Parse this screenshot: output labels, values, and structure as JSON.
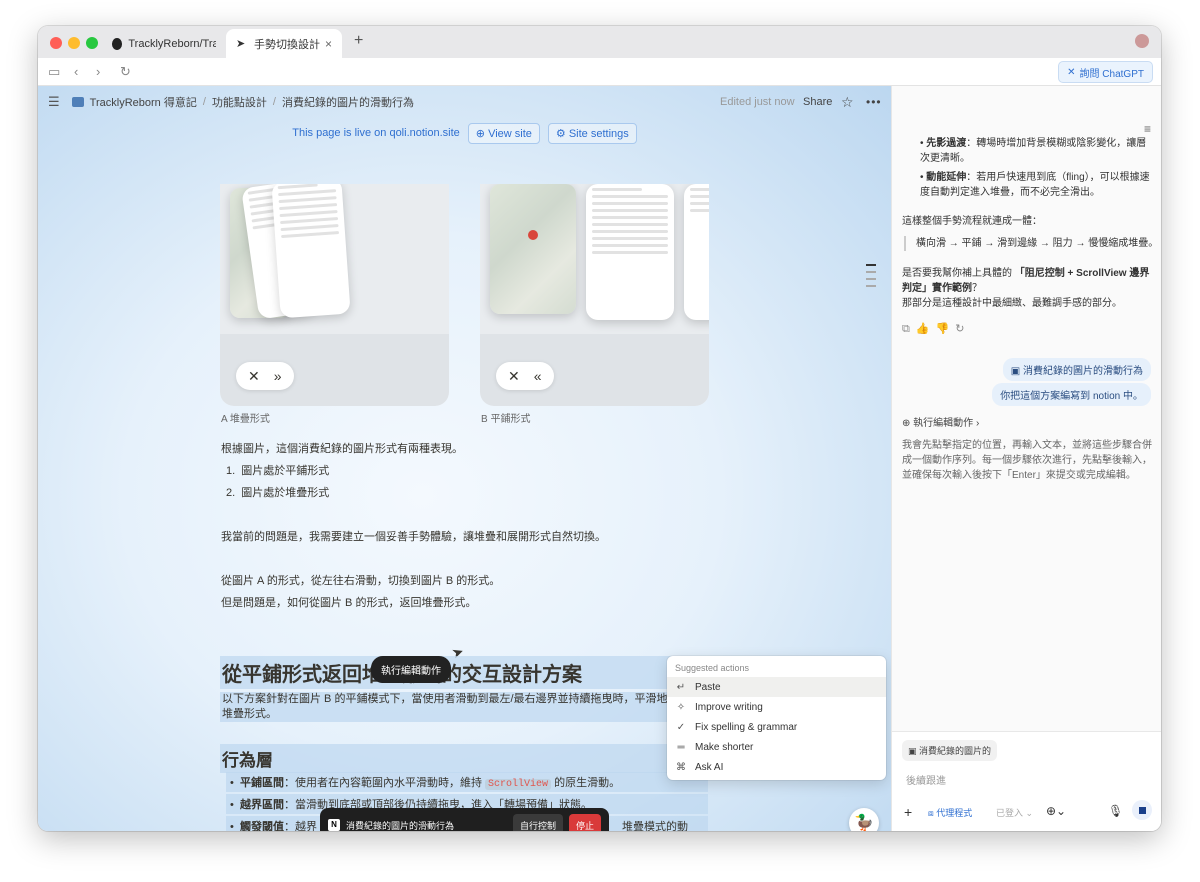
{
  "browser": {
    "tabs": [
      {
        "label": "TracklyReborn/Track"
      },
      {
        "label": "手勢切換設計"
      }
    ],
    "chatgpt_button": "詢問 ChatGPT"
  },
  "notion": {
    "breadcrumb": [
      "TracklyReborn 得意記",
      "功能點設計",
      "消費紀錄的圖片的滑動行為"
    ],
    "edited": "Edited just now",
    "share": "Share",
    "live": {
      "text": "This page is live on qoli.notion.site",
      "view_site": "View site",
      "site_settings": "Site settings"
    },
    "images": [
      {
        "caption": "A 堆疊形式"
      },
      {
        "caption": "B 平鋪形式"
      }
    ],
    "body": {
      "p1": "根據圖片，這個消費紀錄的圖片形式有兩種表現。",
      "list": [
        "圖片處於平鋪形式",
        "圖片處於堆疊形式"
      ],
      "p2": "我當前的問題是，我需要建立一個妥善手勢體驗，讓堆疊和展開形式自然切換。",
      "p3": "從圖片 A 的形式，從左往右滑動，切換到圖片 B 的形式。",
      "p4": "但是問題是，如何從圖片 B 的形式，返回堆疊形式。",
      "h1": "從平鋪形式返回堆疊形式的交互設計方案",
      "p5a": "以下方案針對在圖片 B 的平鋪模式下，當使用者滑動到最左/最右邊界並持續拖曳時，平滑地",
      "p5b": "堆疊形式。",
      "h2": "行為層",
      "bullets": [
        {
          "bold": "平鋪區間",
          "text_a": "：使用者在內容範圍內水平滑動時，維持 ",
          "code": "ScrollView",
          "text_b": " 的原生滑動。"
        },
        {
          "bold": "越界區間",
          "text_a": "：當滑動到底部或頂部後仍持續拖曳，進入「轉場預備」狀態。",
          "code": "",
          "text_b": ""
        },
        {
          "bold": "觸發閾值",
          "text_a": "：越界",
          "code": "",
          "text_b": "堆疊模式的動畫。"
        }
      ]
    },
    "tooltip": "執行編輯動作",
    "menu": {
      "header": "Suggested actions",
      "items": [
        "Paste",
        "Improve writing",
        "Fix spelling & grammar",
        "Make shorter",
        "Ask AI"
      ]
    },
    "agent_bar": {
      "label": "消費紀錄的圖片的滑動行為",
      "self_control": "自行控制",
      "stop": "停止"
    }
  },
  "sidebar": {
    "top_text": "：轉場時增加背景模糊或陰影變化，讓層次更清晰。",
    "top_bold": "先影過渡",
    "momentum_bold": "動能延伸",
    "momentum_text": "：若用戶快速甩到底（fling），可以根據速度自動判定進入堆疊，而不必完全滑出。",
    "summary": "這樣整個手勢流程就連成一體：",
    "flow": "橫向滑 → 平鋪 → 滑到邊緣 → 阻力 → 慢慢縮成堆疊。",
    "question_a": "是否要我幫你補上具體的",
    "question_bold": "「阻尼控制 + ScrollView 邊界判定」實作範例",
    "question_b": "？",
    "question_c": "那部分是這種設計中最細緻、最難調手感的部分。",
    "user_chip": "消費紀錄的圖片的滑動行為",
    "user_msg": "你把這個方案編寫到 notion 中。",
    "action_label": "執行編輯動作",
    "action_desc": "我會先點擊指定的位置，再輸入文本，並將這些步驟合併成一個動作序列。每一個步驟依次進行，先點擊後輸入，並確保每次輸入後按下「Enter」來提交或完成編輯。",
    "composer_chip": "消費紀錄的圖片的",
    "composer_placeholder": "後續跟進",
    "agent_mode": "代理程式",
    "logged_in": "已登入"
  }
}
